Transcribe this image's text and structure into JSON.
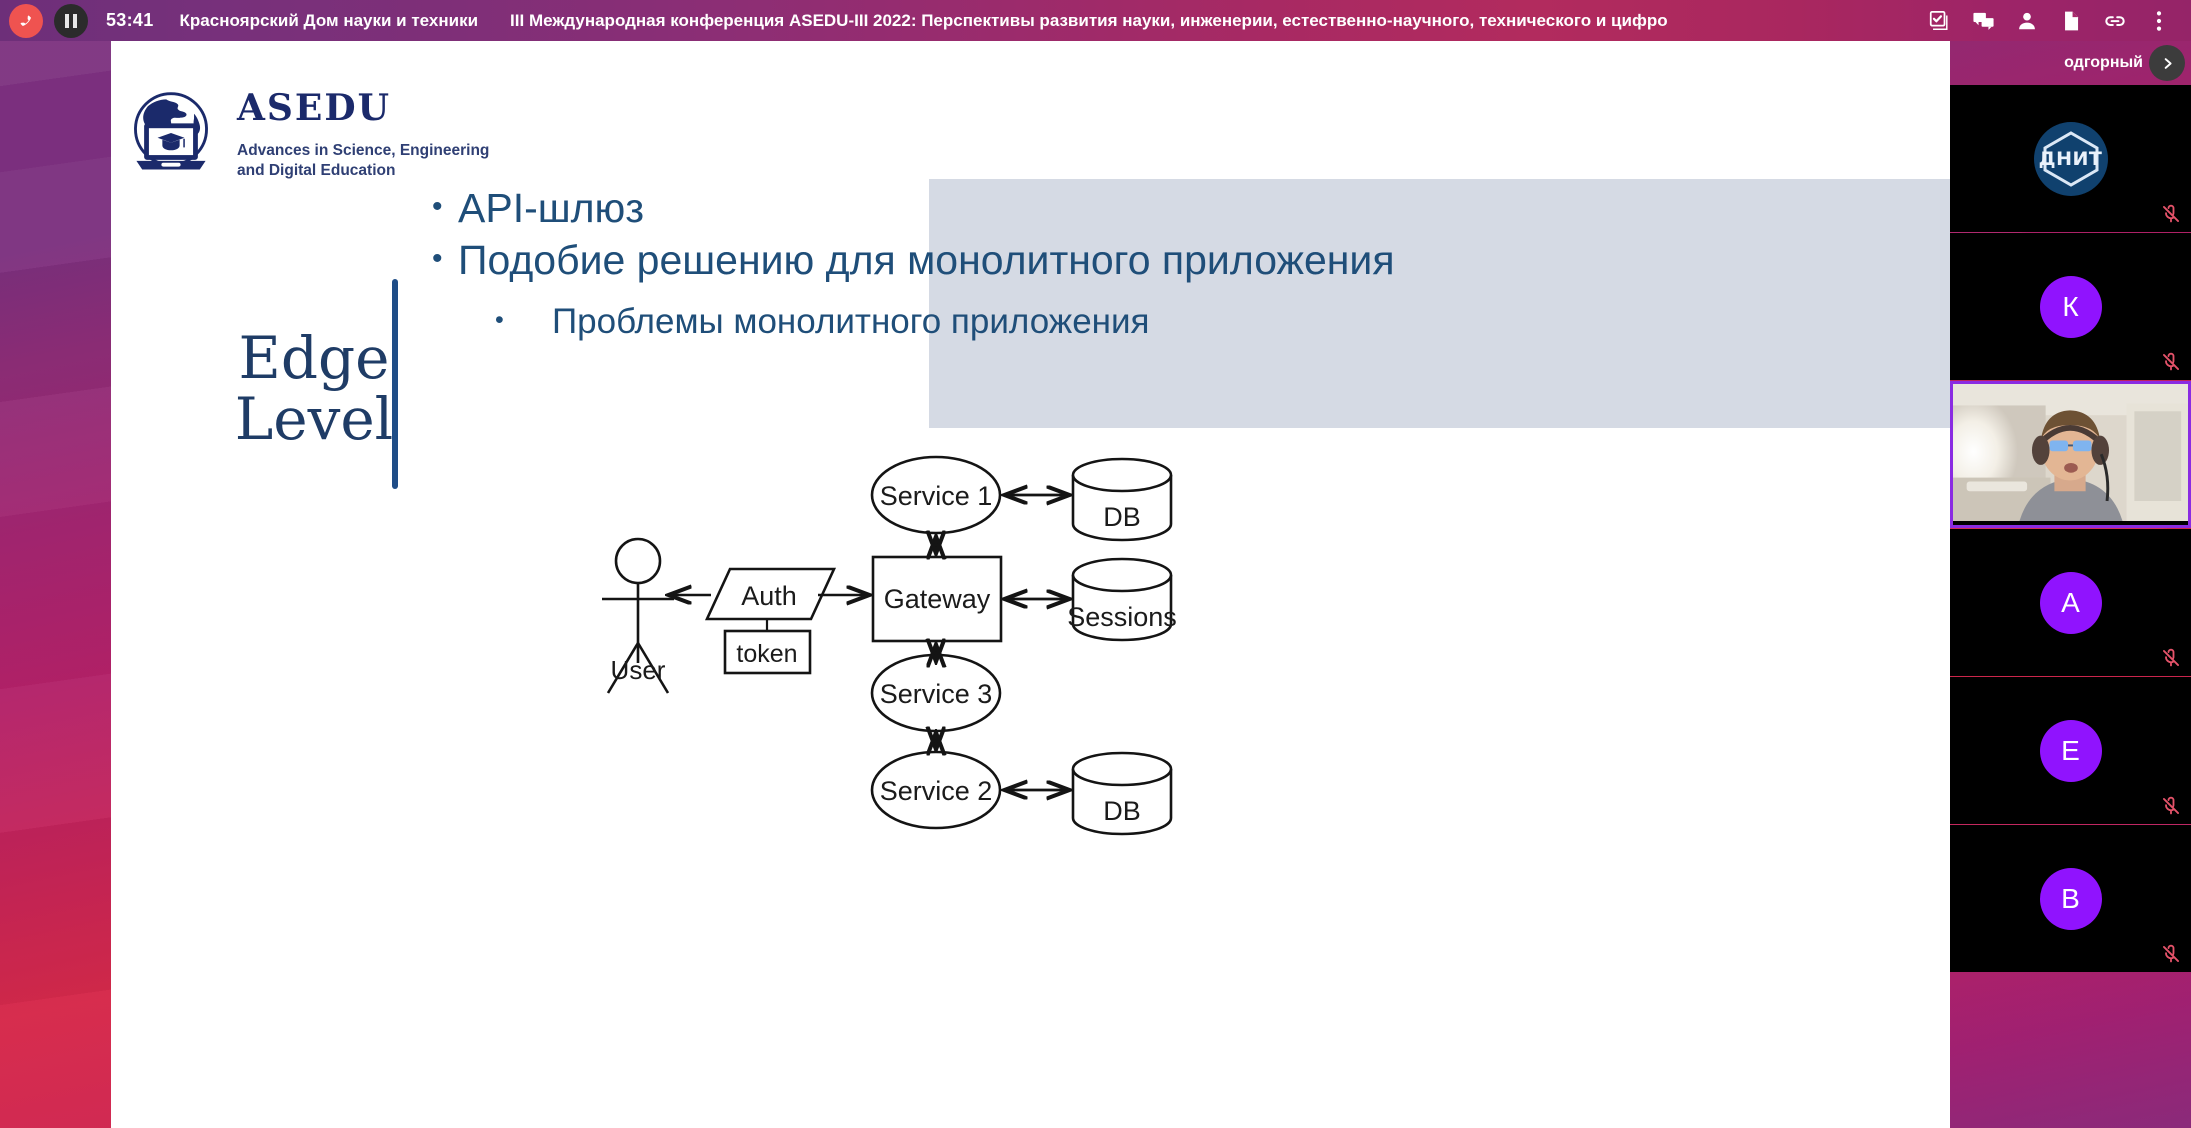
{
  "topbar": {
    "hangup_label": "hang-up",
    "pause_label": "pause",
    "timer": "53:41",
    "org": "Красноярский Дом науки и техники",
    "meeting_title": "III Международная конференция ASEDU-III 2022: Перспективы развития науки, инженерии, естественно-научного, технического и цифро",
    "actions": [
      {
        "name": "poll-icon",
        "label": "Опросы"
      },
      {
        "name": "chat-icon",
        "label": "Чат"
      },
      {
        "name": "participants-icon",
        "label": "Участники"
      },
      {
        "name": "document-icon",
        "label": "Документы"
      },
      {
        "name": "link-icon",
        "label": "Ссылка"
      },
      {
        "name": "more-icon",
        "label": "Ещё"
      }
    ]
  },
  "slide": {
    "logo": {
      "wordmark": "ASEDU",
      "tagline_line1": "Advances in Science, Engineering",
      "tagline_line2": "and Digital Education",
      "icon": "globe-laptop-graduation-cap-icon",
      "brand_color": "#1b2a6b"
    },
    "title_line1": "Edge",
    "title_line2": "Level",
    "accent_color": "#1f4d87",
    "body_color": "#1f4e79",
    "highlight_color": "#d5dae4",
    "bullets": [
      {
        "level": 1,
        "text": "API-шлюз"
      },
      {
        "level": 1,
        "text": "Подобие решению для монолитного приложения"
      },
      {
        "level": 2,
        "text": "Проблемы монолитного приложения"
      }
    ],
    "diagram": {
      "type": "architecture-diagram",
      "actor": "User",
      "nodes": [
        {
          "id": "auth",
          "label": "Auth",
          "shape": "parallelogram"
        },
        {
          "id": "token",
          "label": "token",
          "shape": "rectangle"
        },
        {
          "id": "gateway",
          "label": "Gateway",
          "shape": "rectangle"
        },
        {
          "id": "service1",
          "label": "Service 1",
          "shape": "ellipse"
        },
        {
          "id": "service3",
          "label": "Service 3",
          "shape": "ellipse"
        },
        {
          "id": "service2",
          "label": "Service 2",
          "shape": "ellipse"
        },
        {
          "id": "db1",
          "label": "DB",
          "shape": "cylinder"
        },
        {
          "id": "sessions",
          "label": "Sessions",
          "shape": "cylinder"
        },
        {
          "id": "db2",
          "label": "DB",
          "shape": "cylinder"
        }
      ],
      "edges": [
        {
          "from": "auth",
          "to": "user",
          "arrow": "single"
        },
        {
          "from": "auth",
          "to": "gateway",
          "arrow": "single"
        },
        {
          "from": "auth",
          "to": "token",
          "arrow": "none"
        },
        {
          "from": "gateway",
          "to": "service1",
          "arrow": "double"
        },
        {
          "from": "gateway",
          "to": "service3",
          "arrow": "double"
        },
        {
          "from": "gateway",
          "to": "sessions",
          "arrow": "double"
        },
        {
          "from": "service1",
          "to": "db1",
          "arrow": "double"
        },
        {
          "from": "service3",
          "to": "service2",
          "arrow": "double"
        },
        {
          "from": "service2",
          "to": "db2",
          "arrow": "double"
        }
      ]
    }
  },
  "filmstrip": {
    "speaker_name": "одгорный",
    "next_label": "Следующий",
    "tiles": [
      {
        "kind": "logo",
        "label": "ДНИТ",
        "muted": true,
        "active": false
      },
      {
        "kind": "avatar",
        "label": "К",
        "muted": true,
        "active": false
      },
      {
        "kind": "video",
        "label": "",
        "muted": false,
        "active": true
      },
      {
        "kind": "avatar",
        "label": "A",
        "muted": true,
        "active": false
      },
      {
        "kind": "avatar",
        "label": "E",
        "muted": true,
        "active": false
      },
      {
        "kind": "avatar",
        "label": "B",
        "muted": true,
        "active": false
      }
    ],
    "avatar_color": "#9013fe",
    "active_border_color": "#8a2be2",
    "mic_off_color": "#e5536a"
  }
}
